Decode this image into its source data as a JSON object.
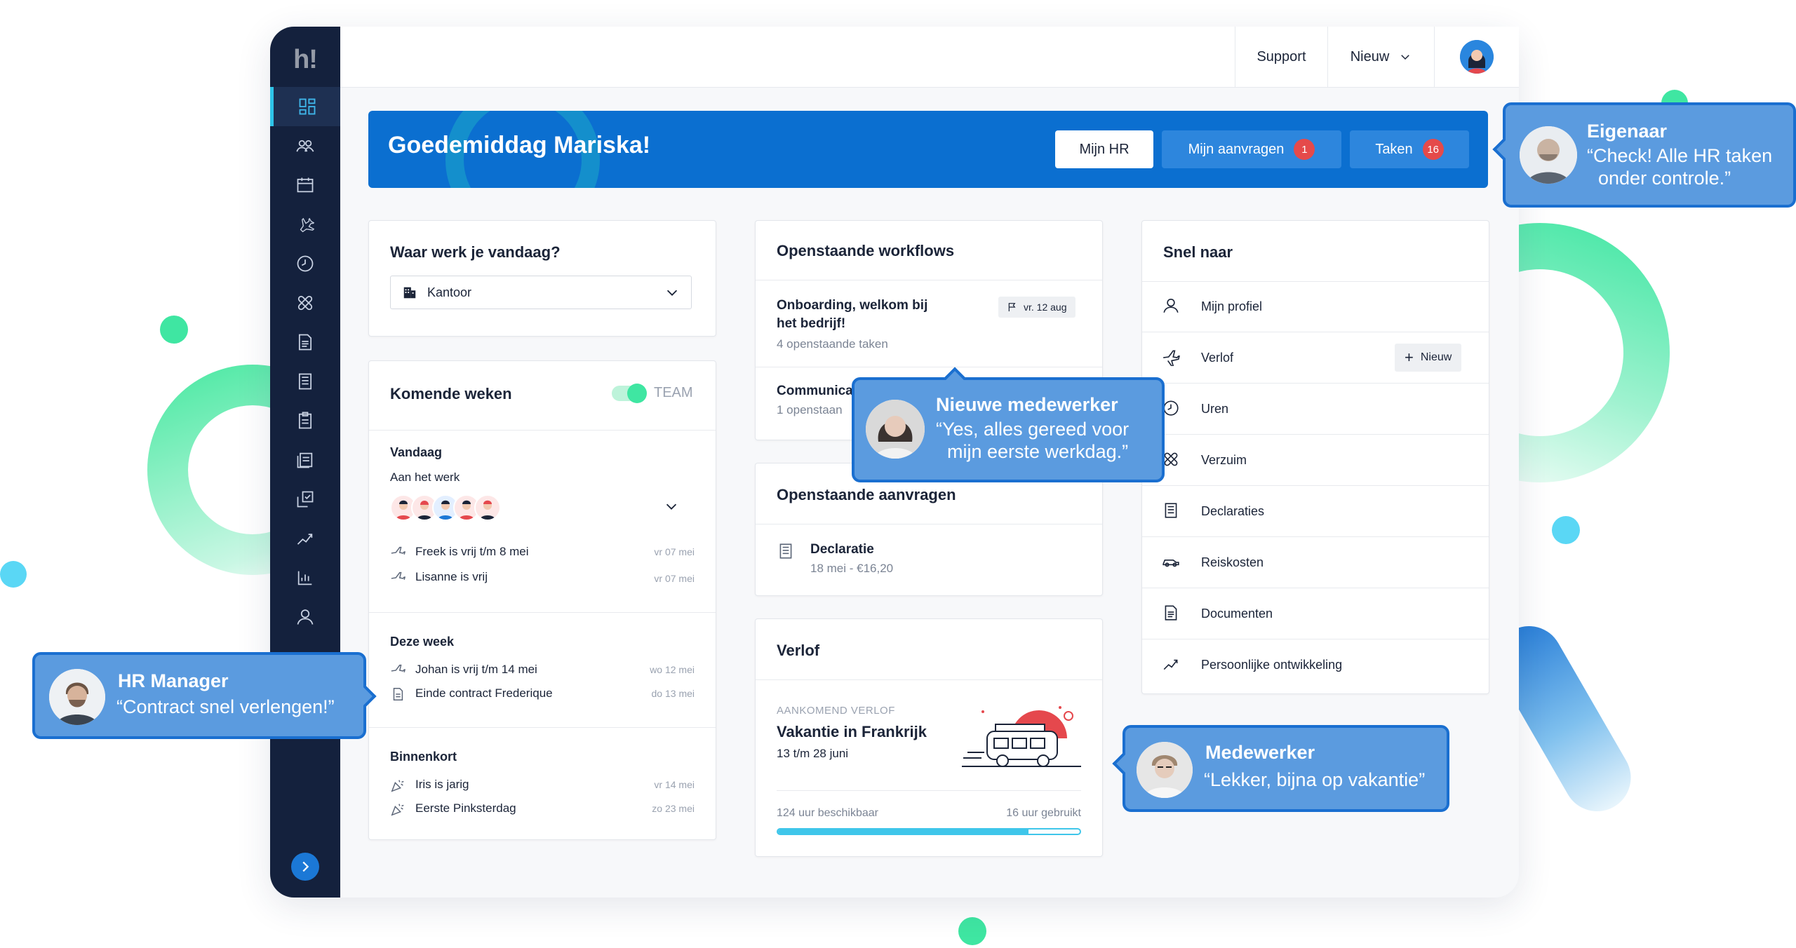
{
  "topbar": {
    "support": "Support",
    "nieuw": "Nieuw"
  },
  "banner": {
    "greeting": "Goedemiddag Mariska!",
    "mijn_hr": "Mijn HR",
    "mijn_aanvragen": "Mijn aanvragen",
    "mijn_aanvragen_count": "1",
    "taken": "Taken",
    "taken_count": "16"
  },
  "werkplek": {
    "title": "Waar werk je vandaag?",
    "selected": "Kantoor"
  },
  "komende": {
    "title": "Komende weken",
    "toggle_label": "TEAM",
    "vandaag": {
      "heading": "Vandaag",
      "subheading": "Aan het werk",
      "items": [
        {
          "text": "Freek is vrij t/m 8 mei",
          "date": "vr 07 mei"
        },
        {
          "text": "Lisanne is vrij",
          "date": "vr 07 mei"
        }
      ]
    },
    "deze_week": {
      "heading": "Deze week",
      "items": [
        {
          "text": "Johan is vrij t/m 14 mei",
          "date": "wo 12 mei"
        },
        {
          "text": "Einde contract Frederique",
          "date": "do 13 mei"
        }
      ]
    },
    "binnenkort": {
      "heading": "Binnenkort",
      "items": [
        {
          "text": "Iris is jarig",
          "date": "vr 14 mei"
        },
        {
          "text": "Eerste Pinksterdag",
          "date": "zo 23 mei"
        }
      ]
    }
  },
  "workflows": {
    "title": "Openstaande workflows",
    "items": [
      {
        "title_line1": "Onboarding, welkom bij",
        "title_line2": "het bedrijf!",
        "sub": "4 openstaande taken",
        "tag": "vr. 12 aug"
      },
      {
        "title_line1": "Communica",
        "sub": "1 openstaan"
      }
    ]
  },
  "aanvragen": {
    "title": "Openstaande aanvragen",
    "item_title": "Declaratie",
    "item_sub": "18 mei - €16,20"
  },
  "verlof": {
    "title": "Verlof",
    "label": "AANKOMEND VERLOF",
    "trip": "Vakantie in Frankrijk",
    "dates": "13 t/m 28 juni",
    "available": "124 uur beschikbaar",
    "used": "16 uur gebruikt",
    "progress": 0.83
  },
  "snel": {
    "title": "Snel naar",
    "new_button": "Nieuw",
    "items": [
      {
        "label": "Mijn profiel",
        "icon": "user-icon"
      },
      {
        "label": "Verlof",
        "icon": "plane-icon"
      },
      {
        "label": "Uren",
        "icon": "clock-icon"
      },
      {
        "label": "Verzuim",
        "icon": "bandage-icon"
      },
      {
        "label": "Declaraties",
        "icon": "receipt-icon"
      },
      {
        "label": "Reiskosten",
        "icon": "car-icon"
      },
      {
        "label": "Documenten",
        "icon": "document-icon"
      },
      {
        "label": "Persoonlijke ontwikkeling",
        "icon": "growth-icon"
      }
    ]
  },
  "bubbles": {
    "eigenaar": {
      "name": "Eigenaar",
      "line1": "“Check! Alle HR taken",
      "line2": "onder controle.”"
    },
    "nieuwe": {
      "name": "Nieuwe medewerker",
      "line1": "“Yes, alles gereed voor",
      "line2": "mijn eerste werkdag.”"
    },
    "hr": {
      "name": "HR Manager",
      "line1": "“Contract snel verlengen!”"
    },
    "medewerker": {
      "name": "Medewerker",
      "line1": "“Lekker, bijna op vakantie”"
    }
  },
  "colors": {
    "brand_blue": "#0b6fd0",
    "sidebar": "#14213d",
    "accent_green": "#3fe6a2",
    "badge_red": "#e54a4a"
  }
}
